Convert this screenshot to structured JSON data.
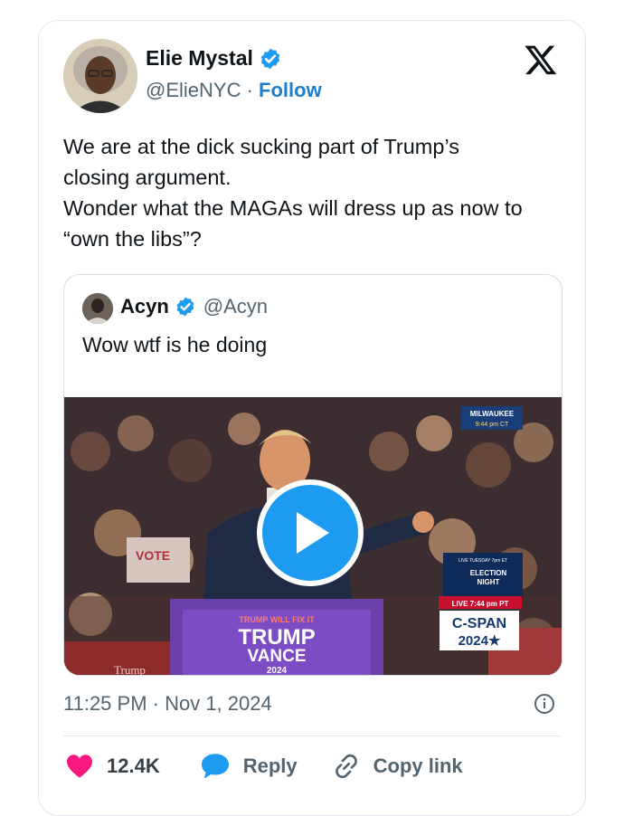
{
  "tweet": {
    "author_name": "Elie Mystal",
    "author_handle": "@ElieNYC",
    "separator": "·",
    "follow_label": "Follow",
    "text_lines": [
      "We are at the dick sucking part of Trump’s",
      "closing argument.",
      "Wonder what the MAGAs will dress up as now to",
      "“own the libs”?"
    ],
    "timestamp": "11:25 PM · Nov 1, 2024"
  },
  "quote": {
    "author_name": "Acyn",
    "author_handle": "@Acyn",
    "text": "Wow wtf is he doing",
    "media": {
      "type": "video",
      "overlay_top_right": [
        "MILWAUKEE",
        "9:44 pm CT"
      ],
      "podium_lines": [
        "TRUMP WILL FIX IT",
        "TRUMP",
        "VANCE",
        "2024"
      ],
      "live_label": "LIVE 7:44 pm PT",
      "election_label": [
        "LIVE TUESDAY 7pm ET",
        "ELECTION",
        "NIGHT"
      ],
      "network": [
        "C-SPAN",
        "2024★"
      ],
      "sign_text": "VOTE",
      "shirt_text": "Trump"
    }
  },
  "actions": {
    "likes": "12.4K",
    "reply_label": "Reply",
    "copy_label": "Copy link"
  },
  "colors": {
    "accent": "#1d9bf0",
    "follow": "#1d7fc9",
    "like": "#f91880",
    "muted": "#536471"
  },
  "icons": [
    "verified-badge-icon",
    "x-logo-icon",
    "play-icon",
    "info-icon",
    "heart-icon",
    "reply-bubble-icon",
    "link-icon"
  ]
}
